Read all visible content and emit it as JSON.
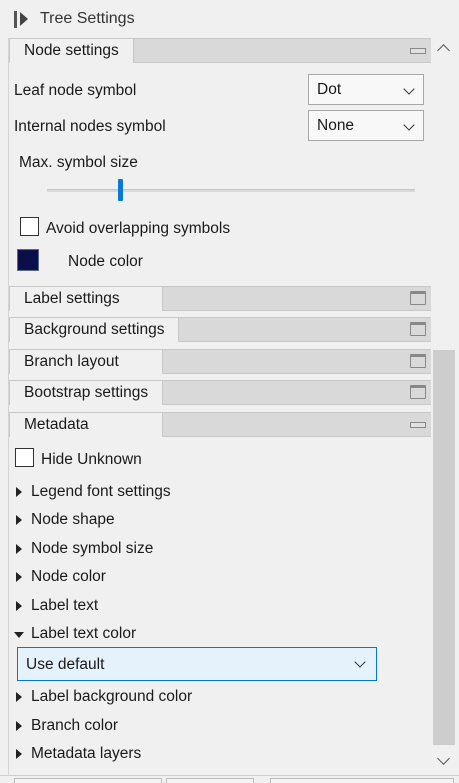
{
  "panel": {
    "title": "Tree Settings"
  },
  "node_settings": {
    "header": "Node settings",
    "leaf_label": "Leaf node symbol",
    "leaf_value": "Dot",
    "internal_label": "Internal nodes symbol",
    "internal_value": "None",
    "max_size_label": "Max. symbol size",
    "max_size_level": 0.2,
    "avoid_overlap_label": "Avoid overlapping symbols",
    "avoid_overlap_checked": false,
    "node_color_label": "Node color",
    "node_color_value": "#0a0f4a"
  },
  "collapsed_sections": {
    "label": "Label settings",
    "background": "Background settings",
    "branch": "Branch layout",
    "bootstrap": "Bootstrap settings"
  },
  "metadata": {
    "header": "Metadata",
    "hide_unknown_label": "Hide Unknown",
    "hide_unknown_checked": false,
    "items": {
      "legend_font": "Legend font settings",
      "node_shape": "Node shape",
      "node_symbol_size": "Node symbol size",
      "node_color": "Node color",
      "label_text": "Label text",
      "label_text_color": "Label text color",
      "label_background_color": "Label background color",
      "branch_color": "Branch color",
      "metadata_layers": "Metadata layers"
    },
    "label_text_color_value": "Use default"
  },
  "colors": {
    "accent": "#0078d7",
    "slider": "#0a78d7",
    "section_bg": "#d9d9d9"
  }
}
